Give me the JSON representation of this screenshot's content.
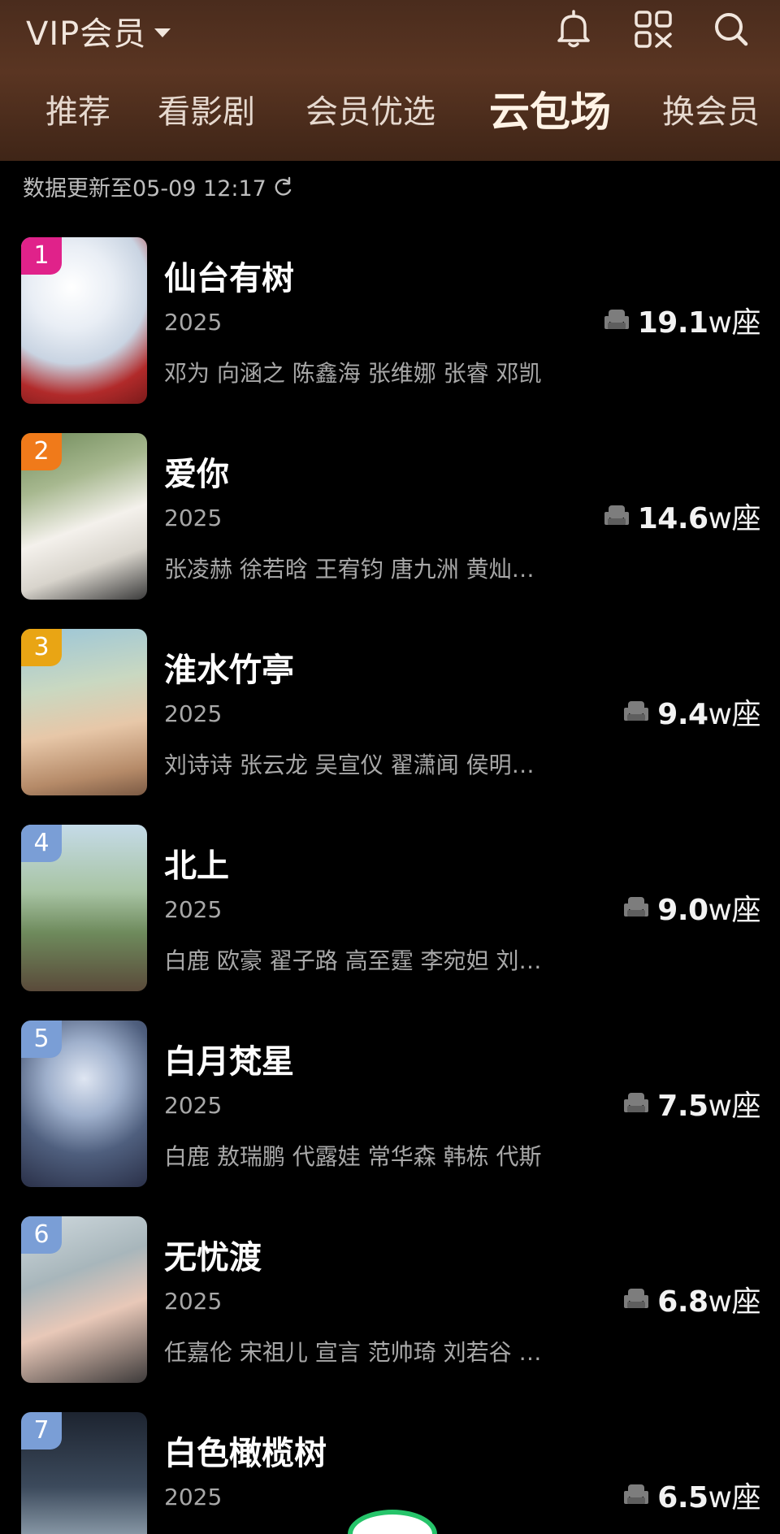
{
  "header": {
    "vip_label": "VIP会员",
    "icons": [
      "bell-icon",
      "qr-code-icon",
      "search-icon"
    ]
  },
  "tabs": [
    {
      "label": "推荐",
      "active": false
    },
    {
      "label": "看影剧",
      "active": false
    },
    {
      "label": "会员优选",
      "active": false
    },
    {
      "label": "云包场",
      "active": true
    },
    {
      "label": "换会员",
      "active": false
    }
  ],
  "update_text": "数据更新至05-09 12:17",
  "list": [
    {
      "rank": "1",
      "title": "仙台有树",
      "year": "2025",
      "cast": "邓为 向涵之 陈鑫海 张维娜 张睿 邓凯",
      "seats": "19.1",
      "unit": "w座",
      "rank_color": "#e0228a"
    },
    {
      "rank": "2",
      "title": "爱你",
      "year": "2025",
      "cast": "张凌赫 徐若晗 王宥钧 唐九洲 黄灿…",
      "seats": "14.6",
      "unit": "w座",
      "rank_color": "#f07a1a"
    },
    {
      "rank": "3",
      "title": "淮水竹亭",
      "year": "2025",
      "cast": "刘诗诗 张云龙 吴宣仪 翟潇闻 侯明…",
      "seats": "9.4",
      "unit": "w座",
      "rank_color": "#e9a514"
    },
    {
      "rank": "4",
      "title": "北上",
      "year": "2025",
      "cast": "白鹿 欧豪 翟子路 高至霆 李宛妲 刘…",
      "seats": "9.0",
      "unit": "w座",
      "rank_color": "#7a9ed6"
    },
    {
      "rank": "5",
      "title": "白月梵星",
      "year": "2025",
      "cast": "白鹿 敖瑞鹏 代露娃 常华森 韩栋 代斯",
      "seats": "7.5",
      "unit": "w座",
      "rank_color": "#7a9ed6"
    },
    {
      "rank": "6",
      "title": "无忧渡",
      "year": "2025",
      "cast": "任嘉伦 宋祖儿 宣言 范帅琦 刘若谷 …",
      "seats": "6.8",
      "unit": "w座",
      "rank_color": "#7a9ed6"
    },
    {
      "rank": "7",
      "title": "白色橄榄树",
      "year": "2025",
      "cast": "",
      "seats": "6.5",
      "unit": "w座",
      "rank_color": "#7a9ed6"
    }
  ]
}
